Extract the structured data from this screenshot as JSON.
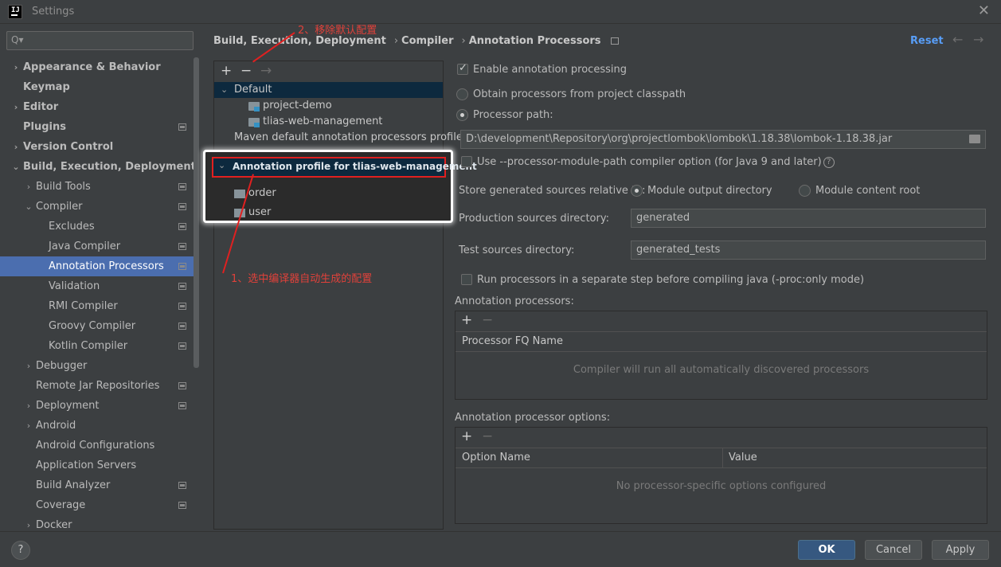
{
  "window": {
    "title": "Settings",
    "logo_text": "IJ",
    "close_glyph": "✕"
  },
  "search": {
    "placeholder": "",
    "icon": "Q▾"
  },
  "sidebar": {
    "items": [
      {
        "label": "Appearance & Behavior",
        "arrow": "›",
        "bold": true
      },
      {
        "label": "Keymap",
        "bold": true
      },
      {
        "label": "Editor",
        "arrow": "›",
        "bold": true
      },
      {
        "label": "Plugins",
        "bold": true
      },
      {
        "label": "Version Control",
        "arrow": "›",
        "bold": true
      },
      {
        "label": "Build, Execution, Deployment",
        "arrow": "⌄",
        "bold": true
      },
      {
        "label": "Build Tools",
        "arrow": "›"
      },
      {
        "label": "Compiler",
        "arrow": "⌄"
      },
      {
        "label": "Excludes"
      },
      {
        "label": "Java Compiler"
      },
      {
        "label": "Annotation Processors"
      },
      {
        "label": "Validation"
      },
      {
        "label": "RMI Compiler"
      },
      {
        "label": "Groovy Compiler"
      },
      {
        "label": "Kotlin Compiler"
      },
      {
        "label": "Debugger",
        "arrow": "›"
      },
      {
        "label": "Remote Jar Repositories"
      },
      {
        "label": "Deployment",
        "arrow": "›"
      },
      {
        "label": "Android",
        "arrow": "›"
      },
      {
        "label": "Android Configurations"
      },
      {
        "label": "Application Servers"
      },
      {
        "label": "Build Analyzer"
      },
      {
        "label": "Coverage"
      },
      {
        "label": "Docker",
        "arrow": "›"
      }
    ]
  },
  "breadcrumb": {
    "part1": "Build, Execution, Deployment",
    "part2": "Compiler",
    "part3": "Annotation Processors",
    "sep": "›"
  },
  "header": {
    "reset_label": "Reset",
    "back_glyph": "←",
    "forward_glyph": "→"
  },
  "profiles": {
    "add_glyph": "+",
    "remove_glyph": "−",
    "move_glyph": "→",
    "default_label": "Default",
    "default_arrow": "⌄",
    "default_children": [
      "project-demo",
      "tlias-web-management"
    ],
    "maven_label": "Maven default annotation processors profile",
    "profile_label": "Annotation profile for tlias-web-management",
    "profile_arrow": "⌄",
    "profile_children": [
      "order",
      "user"
    ]
  },
  "annotations": {
    "step2": "2、移除默认配置",
    "step1": "1、选中编译器自动生成的配置"
  },
  "form": {
    "enable_label": "Enable annotation processing",
    "obtain_label": "Obtain processors from project classpath",
    "processor_path_label": "Processor path:",
    "processor_path_value": "D:\\development\\Repository\\org\\projectlombok\\lombok\\1.18.38\\lombok-1.18.38.jar",
    "module_path_label": "Use --processor-module-path compiler option (for Java 9 and later)",
    "help_glyph": "?",
    "store_label": "Store generated sources relative to:",
    "module_output_label": "Module output directory",
    "module_content_label": "Module content root",
    "production_label": "Production sources directory:",
    "production_value": "generated",
    "test_label": "Test sources directory:",
    "test_value": "generated_tests",
    "run_separate_label": "Run processors in a separate step before compiling java (-proc:only mode)",
    "processors_title": "Annotation processors:",
    "processors_col": "Processor FQ Name",
    "processors_empty": "Compiler will run all automatically discovered processors",
    "options_title": "Annotation processor options:",
    "options_col1": "Option Name",
    "options_col2": "Value",
    "options_empty": "No processor-specific options configured",
    "add_glyph": "+",
    "remove_glyph": "−"
  },
  "footer": {
    "help_glyph": "?",
    "ok_label": "OK",
    "cancel_label": "Cancel",
    "apply_label": "Apply"
  },
  "colors": {
    "accent": "#4b6eaf",
    "link": "#589df6",
    "annotation_red": "#e0413a",
    "primary_button": "#365880"
  }
}
